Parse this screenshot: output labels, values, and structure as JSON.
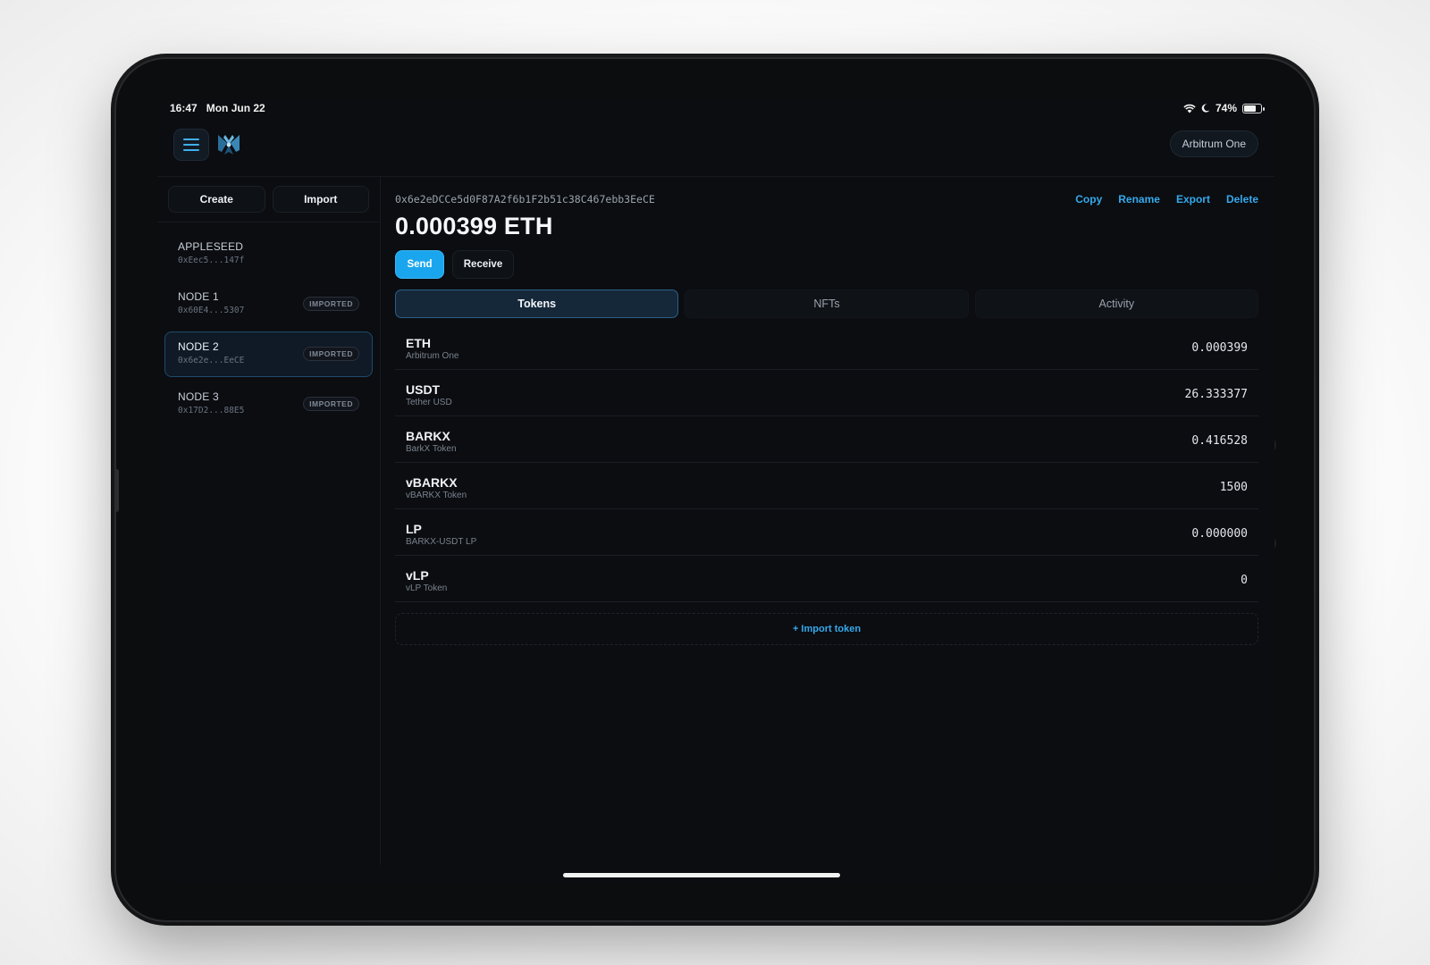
{
  "status": {
    "time": "16:47",
    "date": "Mon Jun 22",
    "battery": "74%",
    "battery_level": 0.74
  },
  "header": {
    "network": "Arbitrum One"
  },
  "sidebar": {
    "create_label": "Create",
    "import_label": "Import",
    "accounts": [
      {
        "name": "APPLESEED",
        "address": "0xEec5...147f",
        "badge": ""
      },
      {
        "name": "NODE 1",
        "address": "0x60E4...5307",
        "badge": "IMPORTED"
      },
      {
        "name": "NODE 2",
        "address": "0x6e2e...EeCE",
        "badge": "IMPORTED",
        "selected": true
      },
      {
        "name": "NODE 3",
        "address": "0x17D2...88E5",
        "badge": "IMPORTED"
      }
    ]
  },
  "wallet": {
    "address": "0x6e2eDCCe5d0F87A2f6b1F2b51c38C467ebb3EeCE",
    "balance": "0.000399 ETH",
    "actions": {
      "copy": "Copy",
      "rename": "Rename",
      "export": "Export",
      "delete": "Delete"
    },
    "send_label": "Send",
    "receive_label": "Receive"
  },
  "tabs": [
    {
      "label": "Tokens",
      "active": true
    },
    {
      "label": "NFTs",
      "active": false
    },
    {
      "label": "Activity",
      "active": false
    }
  ],
  "tokens": [
    {
      "symbol": "ETH",
      "name": "Arbitrum One",
      "amount": "0.000399"
    },
    {
      "symbol": "USDT",
      "name": "Tether USD",
      "amount": "26.333377"
    },
    {
      "symbol": "BARKX",
      "name": "BarkX Token",
      "amount": "0.416528"
    },
    {
      "symbol": "vBARKX",
      "name": "vBARKX Token",
      "amount": "1500"
    },
    {
      "symbol": "LP",
      "name": "BARKX-USDT LP",
      "amount": "0.000000"
    },
    {
      "symbol": "vLP",
      "name": "vLP Token",
      "amount": "0"
    }
  ],
  "import_token_label": "+ Import token",
  "colors": {
    "accent": "#1aa6ee",
    "link": "#36a9ec",
    "background": "#0b0d11"
  },
  "icons": {
    "menu": "hamburger-icon",
    "logo": "app-logo-icon",
    "wifi": "wifi-icon",
    "moon": "moon-icon",
    "battery": "battery-icon"
  }
}
